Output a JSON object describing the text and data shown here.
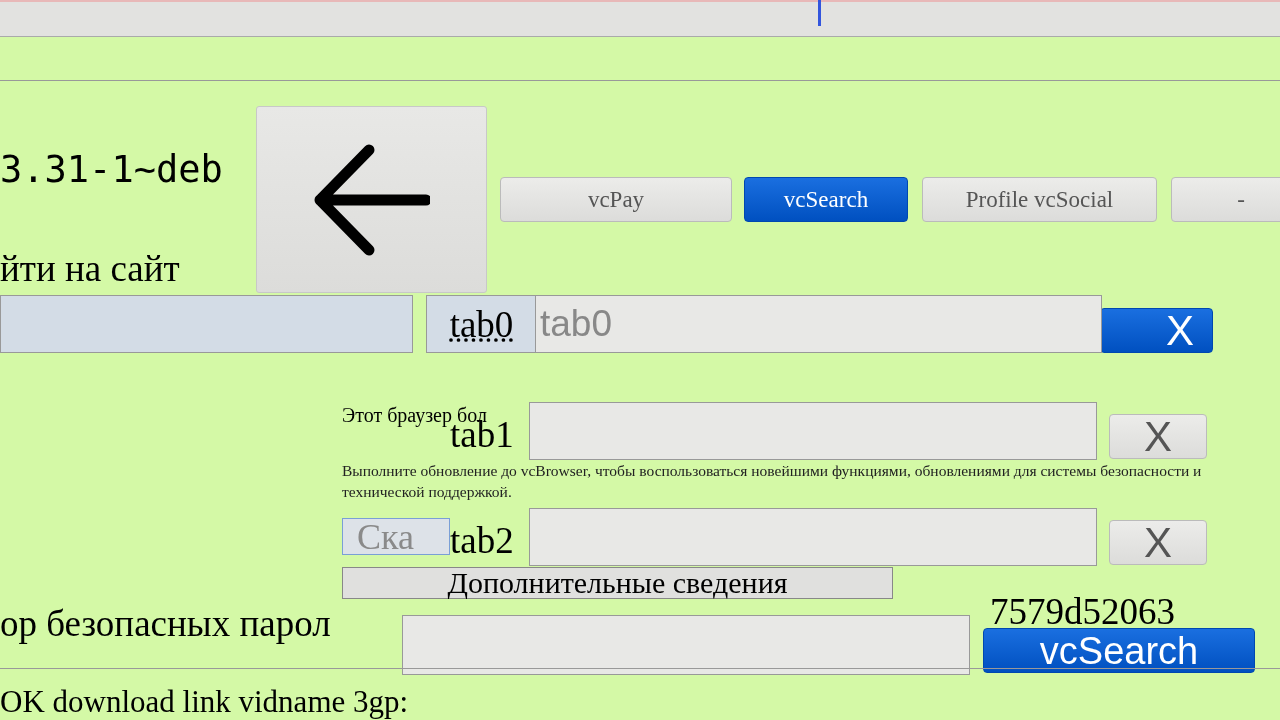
{
  "version": "3.31-1~deb",
  "nav_buttons": [
    {
      "label": "vcPay",
      "selected": false
    },
    {
      "label": "vcSearch",
      "selected": true
    },
    {
      "label": "Profile vcSocial",
      "selected": false
    },
    {
      "label": "-",
      "selected": false
    }
  ],
  "site_link": "йти на сайт",
  "tabs": [
    {
      "label": "tab0",
      "placeholder": "tab0",
      "close": "X",
      "selected": true
    },
    {
      "label": "tab1",
      "close": "X",
      "selected": false
    },
    {
      "label": "tab2",
      "close": "X",
      "selected": false
    }
  ],
  "notice": "Этот браузер бол",
  "update_text": "Выполните обновление до vcBrowser, чтобы воспользоваться новейшими функциями, обновлениями для системы безопасности и технической поддержкой.",
  "download_button": "Ска",
  "more_info_button": "Дополнительные сведения",
  "password_label": "ор безопасных парол",
  "password_tail": "7579d52063",
  "search_button": "vcSearch",
  "download_link": "OK download link vidname 3gp:"
}
